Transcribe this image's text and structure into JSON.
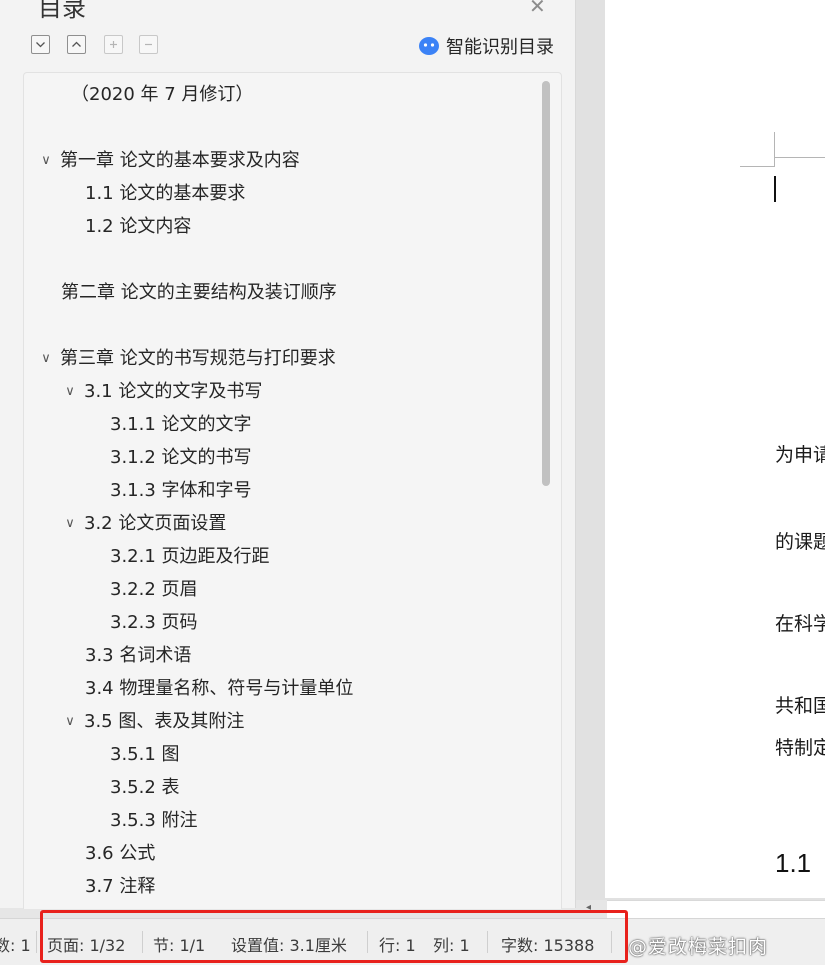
{
  "nav_pane": {
    "title": "目录",
    "close_icon": "close-icon",
    "toolbar": [
      {
        "name": "expand-all-button",
        "icon": "chevron-down-icon",
        "glyph": "⌄"
      },
      {
        "name": "collapse-all-button",
        "icon": "chevron-up-icon",
        "glyph": "⌃"
      },
      {
        "name": "add-level-button",
        "icon": "plus-icon",
        "glyph": "+"
      },
      {
        "name": "remove-level-button",
        "icon": "minus-icon",
        "glyph": "−"
      }
    ],
    "smart_button_label": "智能识别目录",
    "toc": [
      {
        "text": "（2020 年 7 月修订）"
      },
      {
        "text": "第一章   论文的基本要求及内容"
      },
      {
        "text": "1.1   论文的基本要求"
      },
      {
        "text": "1.2   论文内容"
      },
      {
        "text": "第二章   论文的主要结构及装订顺序"
      },
      {
        "text": "第三章   论文的书写规范与打印要求"
      },
      {
        "text": "3.1   论文的文字及书写"
      },
      {
        "text": "3.1.1   论文的文字"
      },
      {
        "text": "3.1.2   论文的书写"
      },
      {
        "text": "3.1.3   字体和字号"
      },
      {
        "text": "3.2   论文页面设置"
      },
      {
        "text": "3.2.1   页边距及行距"
      },
      {
        "text": "3.2.2   页眉"
      },
      {
        "text": "3.2.3   页码"
      },
      {
        "text": "3.3   名词术语"
      },
      {
        "text": "3.4   物理量名称、符号与计量单位"
      },
      {
        "text": "3.5   图、表及其附注"
      },
      {
        "text": "3.5.1  图"
      },
      {
        "text": "3.5.2  表"
      },
      {
        "text": "3.5.3  附注"
      },
      {
        "text": "3.6   公式"
      },
      {
        "text": "3.7   注释"
      }
    ]
  },
  "document": {
    "lines": [
      "为申请",
      "的课题",
      "在科学",
      "共和国",
      "特制定"
    ],
    "heading": "1.1"
  },
  "status_bar": {
    "left_partial": "数: 1",
    "page": "页面: 1/32",
    "section": "节: 1/1",
    "setting": "设置值: 3.1厘米",
    "row": "行: 1",
    "column": "列: 1",
    "word_count": "字数: 15388"
  },
  "watermark": "@爱改梅菜扣肉",
  "colors": {
    "highlight": "#e8211c",
    "smart_icon": "#3b82f6"
  }
}
